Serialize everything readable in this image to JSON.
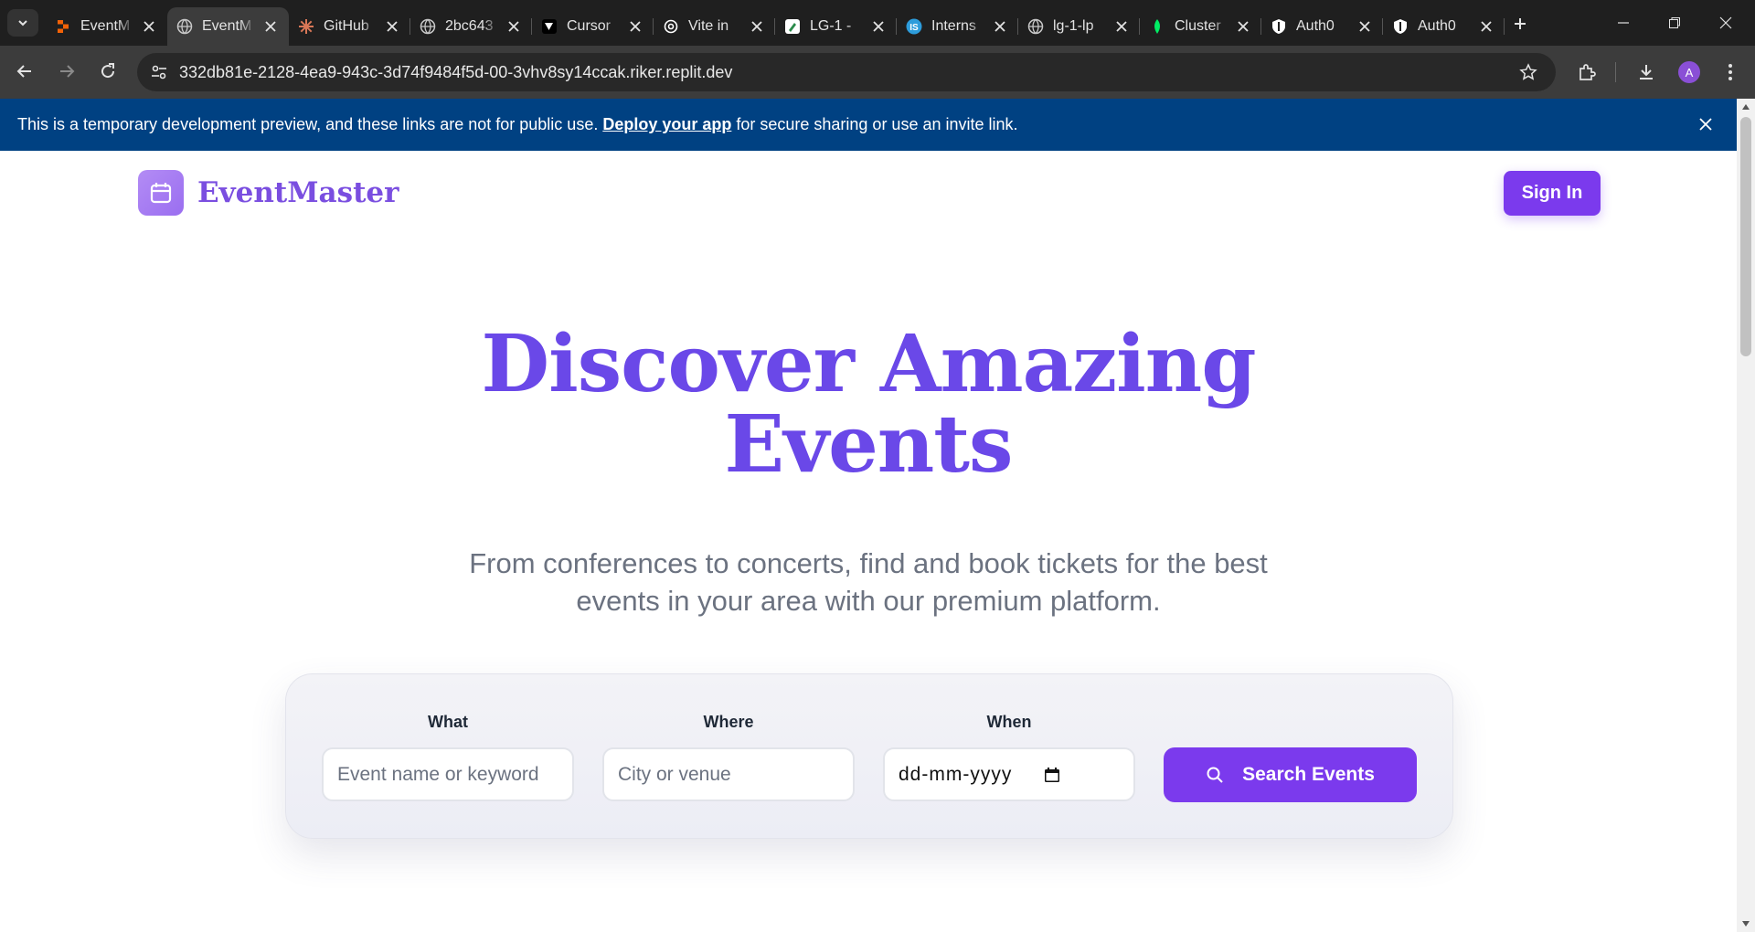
{
  "browser": {
    "tabs": [
      {
        "title": "EventM",
        "icon": "replit-icon",
        "color": "#f26207"
      },
      {
        "title": "EventM",
        "icon": "globe-icon",
        "color": "#c8c8c8"
      },
      {
        "title": "GitHub",
        "icon": "claude-icon",
        "color": "#d97757"
      },
      {
        "title": "2bc643",
        "icon": "globe-icon",
        "color": "#c8c8c8"
      },
      {
        "title": "Cursor",
        "icon": "cursor-icon",
        "color": "#ffffff"
      },
      {
        "title": "Vite in",
        "icon": "openai-icon",
        "color": "#ffffff"
      },
      {
        "title": "LG-1 -",
        "icon": "pen-icon",
        "color": "#ffffff"
      },
      {
        "title": "Interns",
        "icon": "is-icon",
        "color": "#2d9cdb"
      },
      {
        "title": "lg-1-lp",
        "icon": "globe-icon",
        "color": "#c8c8c8"
      },
      {
        "title": "Cluster",
        "icon": "mongodb-icon",
        "color": "#00ed64"
      },
      {
        "title": "Auth0",
        "icon": "auth0-icon",
        "color": "#ffffff"
      },
      {
        "title": "Auth0",
        "icon": "auth0-icon",
        "color": "#ffffff"
      }
    ],
    "url": "332db81e-2128-4ea9-943c-3d74f9484f5d-00-3vhv8sy14ccak.riker.replit.dev",
    "avatar_letter": "A"
  },
  "banner": {
    "text_before": "This is a temporary development preview, and these links are not for public use.",
    "link": "Deploy your app",
    "text_after": "for secure sharing or use an invite link."
  },
  "header": {
    "logo_text": "EventMaster",
    "signin_label": "Sign In"
  },
  "hero": {
    "title_line1": "Discover Amazing",
    "title_line2": "Events",
    "subtitle_line1": "From conferences to concerts, find and book tickets for the best",
    "subtitle_line2": "events in your area with our premium platform."
  },
  "search": {
    "what_label": "What",
    "what_placeholder": "Event name or keyword",
    "where_label": "Where",
    "where_placeholder": "City or venue",
    "when_label": "When",
    "when_value": "dd-mm-yyyy",
    "button_label": "Search Events"
  },
  "colors": {
    "brand": "#7b3aed",
    "title": "#6a48e8",
    "banner": "#004182"
  }
}
